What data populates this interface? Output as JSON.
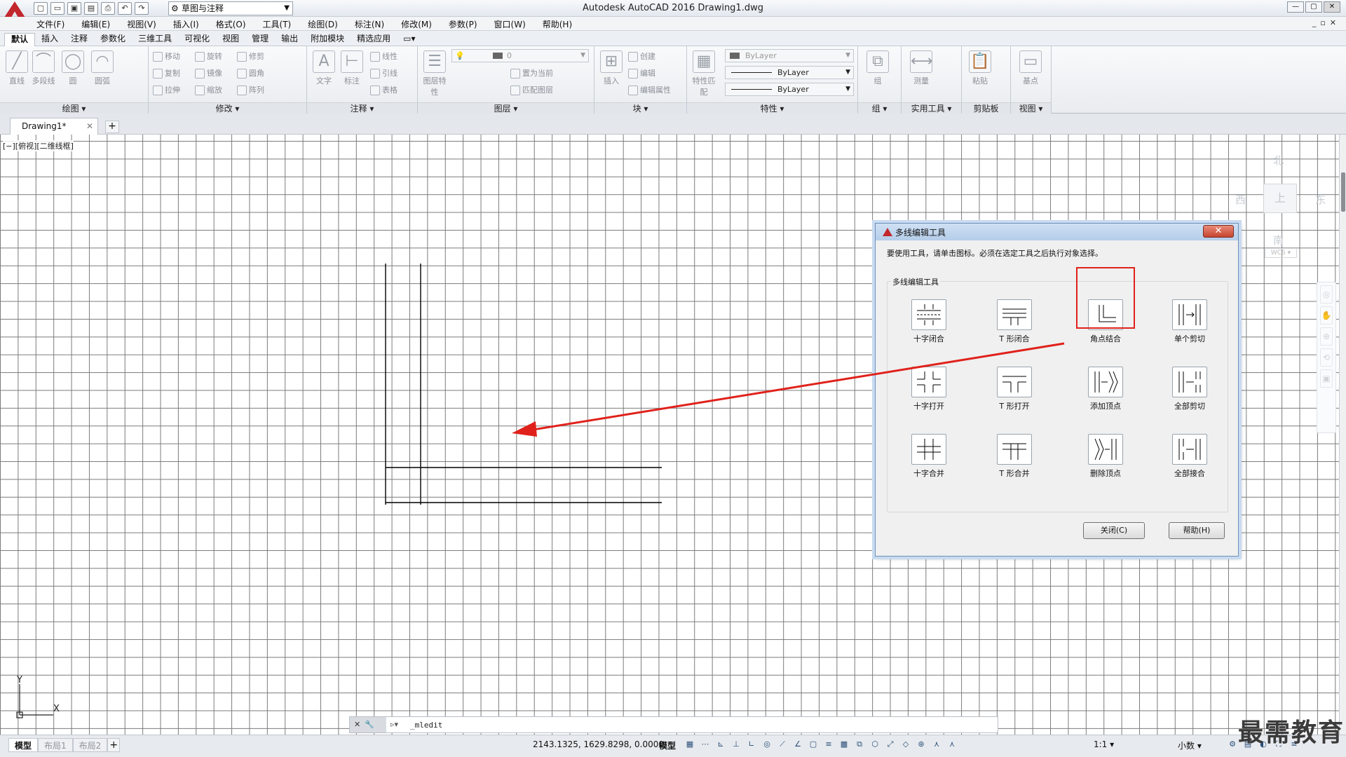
{
  "app": {
    "window_title": "Autodesk AutoCAD 2016    Drawing1.dwg",
    "workspace": "草图与注释"
  },
  "menu": [
    "文件(F)",
    "编辑(E)",
    "视图(V)",
    "插入(I)",
    "格式(O)",
    "工具(T)",
    "绘图(D)",
    "标注(N)",
    "修改(M)",
    "参数(P)",
    "窗口(W)",
    "帮助(H)"
  ],
  "ribbon_tabs": [
    "默认",
    "插入",
    "注释",
    "参数化",
    "三维工具",
    "可视化",
    "视图",
    "管理",
    "输出",
    "附加模块",
    "精选应用"
  ],
  "ribbon": {
    "draw": {
      "title": "绘图",
      "tools": [
        "直线",
        "多段线",
        "圆",
        "圆弧"
      ]
    },
    "modify": {
      "title": "修改",
      "tools": [
        "移动",
        "旋转",
        "修剪",
        "复制",
        "镜像",
        "圆角",
        "拉伸",
        "缩放",
        "阵列"
      ]
    },
    "annotation": {
      "title": "注释",
      "tools": [
        "文字",
        "标注",
        "线性",
        "引线",
        "表格"
      ]
    },
    "layers": {
      "title": "图层",
      "tools": [
        "图层特性",
        "置为当前",
        "匹配图层"
      ],
      "current_layer": "0"
    },
    "block": {
      "title": "块",
      "tools": [
        "插入",
        "创建",
        "编辑",
        "编辑属性"
      ]
    },
    "properties": {
      "title": "特性",
      "tools": [
        "特性匹配"
      ],
      "color": "ByLayer",
      "linetype": "ByLayer",
      "lineweight": "ByLayer"
    },
    "groups": {
      "title": "组",
      "tools": [
        "组"
      ]
    },
    "utilities": {
      "title": "实用工具",
      "tools": [
        "测量"
      ]
    },
    "clipboard": {
      "title": "剪贴板",
      "tools": [
        "粘贴"
      ]
    },
    "view": {
      "title": "视图",
      "tools": [
        "基点"
      ]
    }
  },
  "file_tab": "Drawing1*",
  "viewport_label": "[−][俯视][二维线框]",
  "viewcube": {
    "north": "北",
    "south": "南",
    "east": "东",
    "west": "西",
    "face": "上",
    "wcs": "WCS"
  },
  "ucs": {
    "x": "X",
    "y": "Y"
  },
  "command_line": {
    "value": "_mledit"
  },
  "status": {
    "layout_tabs": [
      "模型",
      "布局1",
      "布局2"
    ],
    "coordinates": "2143.1325, 1629.8298, 0.0000",
    "space": "模型",
    "annotation_scale": "1:1",
    "units": "小数"
  },
  "watermark": "最需教育",
  "dialog": {
    "title": "多线编辑工具",
    "instruction": "要使用工具，请单击图标。必须在选定工具之后执行对象选择。",
    "group_label": "多线编辑工具",
    "tools": [
      {
        "label": "十字闭合",
        "icon": "cross-closed-icon"
      },
      {
        "label": "T 形闭合",
        "icon": "tee-closed-icon"
      },
      {
        "label": "角点结合",
        "icon": "corner-joint-icon"
      },
      {
        "label": "单个剪切",
        "icon": "cut-single-icon"
      },
      {
        "label": "十字打开",
        "icon": "cross-open-icon"
      },
      {
        "label": "T 形打开",
        "icon": "tee-open-icon"
      },
      {
        "label": "添加顶点",
        "icon": "add-vertex-icon"
      },
      {
        "label": "全部剪切",
        "icon": "cut-all-icon"
      },
      {
        "label": "十字合并",
        "icon": "cross-merged-icon"
      },
      {
        "label": "T 形合并",
        "icon": "tee-merged-icon"
      },
      {
        "label": "删除顶点",
        "icon": "delete-vertex-icon"
      },
      {
        "label": "全部接合",
        "icon": "weld-all-icon"
      }
    ],
    "highlighted_tool": "角点结合",
    "close_button": "关闭(C)",
    "help_button": "帮助(H)"
  },
  "colors": {
    "accent_red": "#e0211b",
    "autocad_red": "#c1272d"
  }
}
